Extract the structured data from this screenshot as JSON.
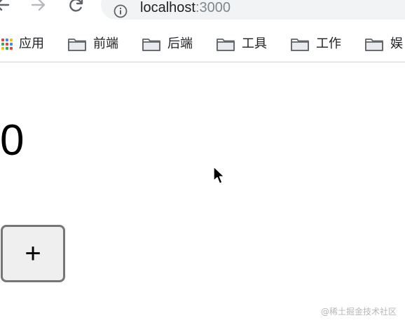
{
  "browser": {
    "address_bar": {
      "host": "localhost",
      "port": ":3000"
    }
  },
  "bookmarks_bar": {
    "items": [
      {
        "label": "应用",
        "icon": "apps-grid-icon"
      },
      {
        "label": "前端",
        "icon": "folder-icon"
      },
      {
        "label": "后端",
        "icon": "folder-icon"
      },
      {
        "label": "工具",
        "icon": "folder-icon"
      },
      {
        "label": "工作",
        "icon": "folder-icon"
      },
      {
        "label": "娱",
        "icon": "folder-icon"
      }
    ]
  },
  "app": {
    "counter_value": "0",
    "increment_label": "+"
  },
  "watermark": "@稀土掘金技术社区",
  "colors": {
    "apps_grid": [
      "#ea4335",
      "#4285f4",
      "#fbbc05",
      "#34a853",
      "#ea4335",
      "#4285f4",
      "#fbbc05",
      "#34a853",
      "#ea4335"
    ],
    "button_border": "#767676",
    "button_background": "#efefef"
  }
}
